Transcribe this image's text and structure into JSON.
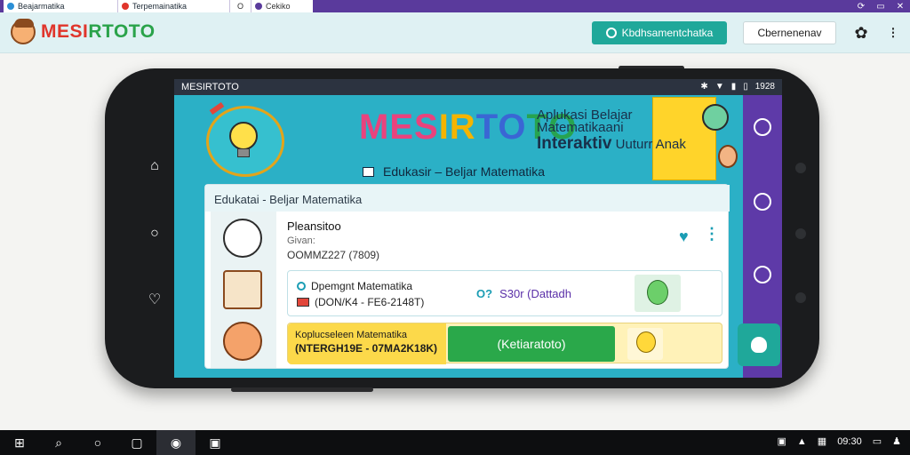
{
  "browser": {
    "tabs": [
      {
        "label": "Beajarmatika"
      },
      {
        "label": "Terpemainatika"
      },
      {
        "label": "O"
      },
      {
        "label": "Cekiko"
      }
    ],
    "window_controls": {
      "back": "⟳",
      "minimize": "▭",
      "close": "✕"
    }
  },
  "header": {
    "logo_part1": "MESI",
    "logo_part2": "RTOTO",
    "primary_button": "Kbdhsamentchatka",
    "secondary_button": "Cbernenenav",
    "settings_icon": "gear-icon",
    "more_icon": "more-vertical-icon"
  },
  "phone": {
    "status_title": "MESIRTOTO",
    "status_time": "1928",
    "hero": {
      "title_parts": [
        "MES",
        "IR",
        "TO",
        "TO"
      ],
      "subtitle_line1": "Aplukasi Belajar",
      "subtitle_line2": "Matematikaani",
      "subtitle_line3": "Interaktiv",
      "subtitle_line3b": "Uuturr Anak",
      "caption": "Edukasir – Beljar Matematika"
    },
    "card": {
      "header": "Edukatai - Beljar Matematika",
      "item_title": "Pleansitoo",
      "item_sub": "Givan:",
      "item_code": "OOMMZ227 (7809)",
      "row1": {
        "title": "Dpemgnt Matematika",
        "code": "(DON/K4 - FE6-2148T)",
        "mid_symbol": "O?",
        "mid_text": "S30r (Dattadh"
      },
      "row2": {
        "line1": "Koplucseleen Matematika",
        "line2": "(NTERGH19E - 07MA2K18K)",
        "button": "(Ketiaratoto)"
      }
    }
  },
  "taskbar": {
    "start": "⊞",
    "search": "⌕",
    "task_view": "○",
    "files": "▢",
    "clock": "09:30"
  }
}
